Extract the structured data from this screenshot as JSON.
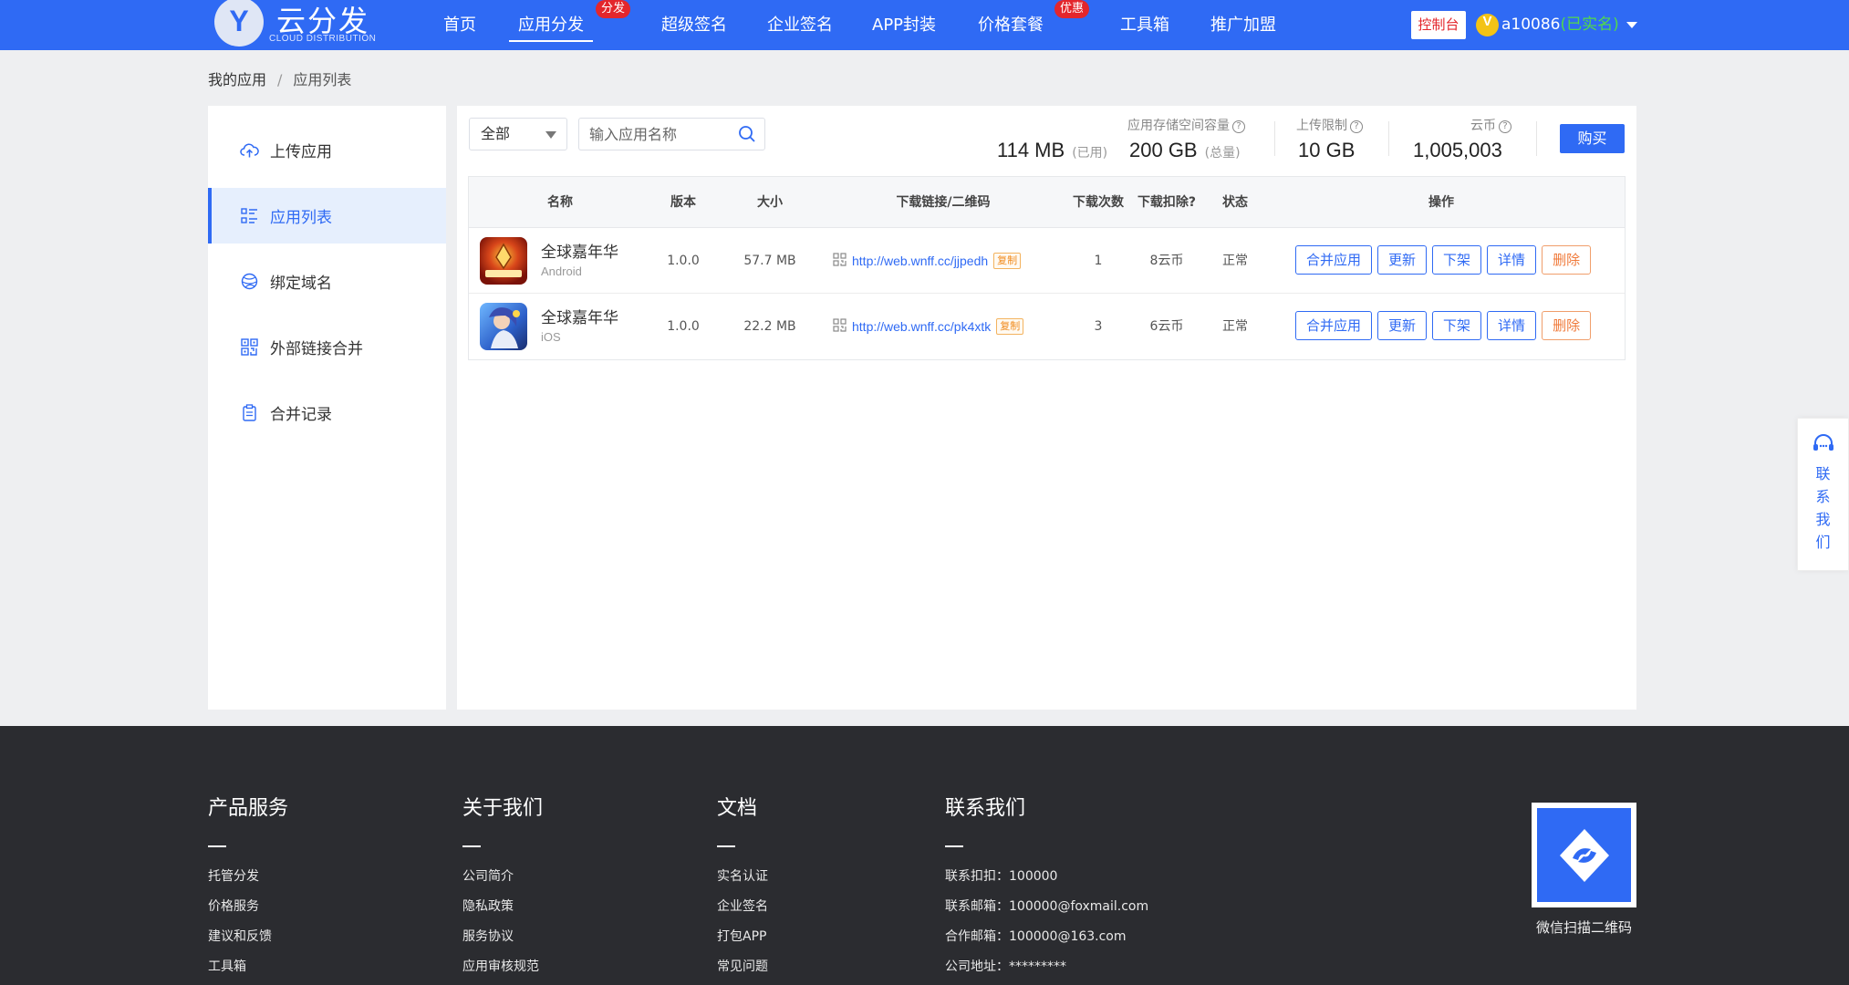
{
  "header": {
    "logo_mark": "Y",
    "logo_text": "云分发",
    "logo_subtext": "CLOUD DISTRIBUTION",
    "nav": [
      {
        "label": "首页"
      },
      {
        "label": "应用分发",
        "tag": "分发"
      },
      {
        "label": "超级签名"
      },
      {
        "label": "企业签名"
      },
      {
        "label": "APP封装"
      },
      {
        "label": "价格套餐",
        "tag": "优惠"
      },
      {
        "label": "工具箱"
      },
      {
        "label": "推广加盟"
      }
    ],
    "console_label": "控制台",
    "vip_badge": "V",
    "username": "a10086",
    "verify_status": "(已实名)"
  },
  "breadcrumb": {
    "root": "我的应用",
    "separator": "/",
    "current": "应用列表"
  },
  "sidebar": {
    "items": [
      {
        "label": "上传应用",
        "icon": "cloud-upload-icon"
      },
      {
        "label": "应用列表",
        "icon": "list-icon"
      },
      {
        "label": "绑定域名",
        "icon": "globe-icon"
      },
      {
        "label": "外部链接合并",
        "icon": "qrcode-icon"
      },
      {
        "label": "合并记录",
        "icon": "clipboard-icon"
      }
    ]
  },
  "toolbar": {
    "filter_selected": "全部",
    "search_placeholder": "输入应用名称"
  },
  "stats": {
    "storage_label": "应用存储空间容量",
    "used_value": "114 MB",
    "used_unit": "(已用)",
    "total_value": "200 GB",
    "total_unit": "(总量)",
    "upload_limit_label": "上传限制",
    "upload_limit_value": "10 GB",
    "coins_label": "云币",
    "coins_value": "1,005,003",
    "buy_label": "购买"
  },
  "table": {
    "headers": {
      "name": "名称",
      "version": "版本",
      "size": "大小",
      "link": "下载链接/二维码",
      "downloads": "下载次数",
      "deduction": "下载扣除?",
      "status": "状态",
      "actions": "操作"
    },
    "rows": [
      {
        "name": "全球嘉年华",
        "platform": "Android",
        "version": "1.0.0",
        "size": "57.7 MB",
        "link": "http://web.wnff.cc/jjpedh",
        "copy": "复制",
        "downloads": "1",
        "deduction": "8云币",
        "status": "正常"
      },
      {
        "name": "全球嘉年华",
        "platform": "iOS",
        "version": "1.0.0",
        "size": "22.2 MB",
        "link": "http://web.wnff.cc/pk4xtk",
        "copy": "复制",
        "downloads": "3",
        "deduction": "6云币",
        "status": "正常"
      }
    ],
    "actions": {
      "merge": "合并应用",
      "update": "更新",
      "unlist": "下架",
      "detail": "详情",
      "delete": "删除"
    }
  },
  "contact_float": {
    "label": "联系我们"
  },
  "footer": {
    "products": {
      "title": "产品服务",
      "links": [
        "托管分发",
        "价格服务",
        "建议和反馈",
        "工具箱"
      ]
    },
    "about": {
      "title": "关于我们",
      "links": [
        "公司简介",
        "隐私政策",
        "服务协议",
        "应用审核规范"
      ]
    },
    "docs": {
      "title": "文档",
      "links": [
        "实名认证",
        "企业签名",
        "打包APP",
        "常见问题"
      ]
    },
    "contact": {
      "title": "联系我们",
      "lines": [
        "联系扣扣：100000",
        "联系邮箱：100000@foxmail.com",
        "合作邮箱：100000@163.com",
        "公司地址：*********"
      ]
    },
    "qr_caption": "微信扫描二维码"
  },
  "colors": {
    "brand": "#2f6af4",
    "danger": "#e3262c",
    "footer_bg": "#2b2c30",
    "verified": "#52d94a"
  }
}
